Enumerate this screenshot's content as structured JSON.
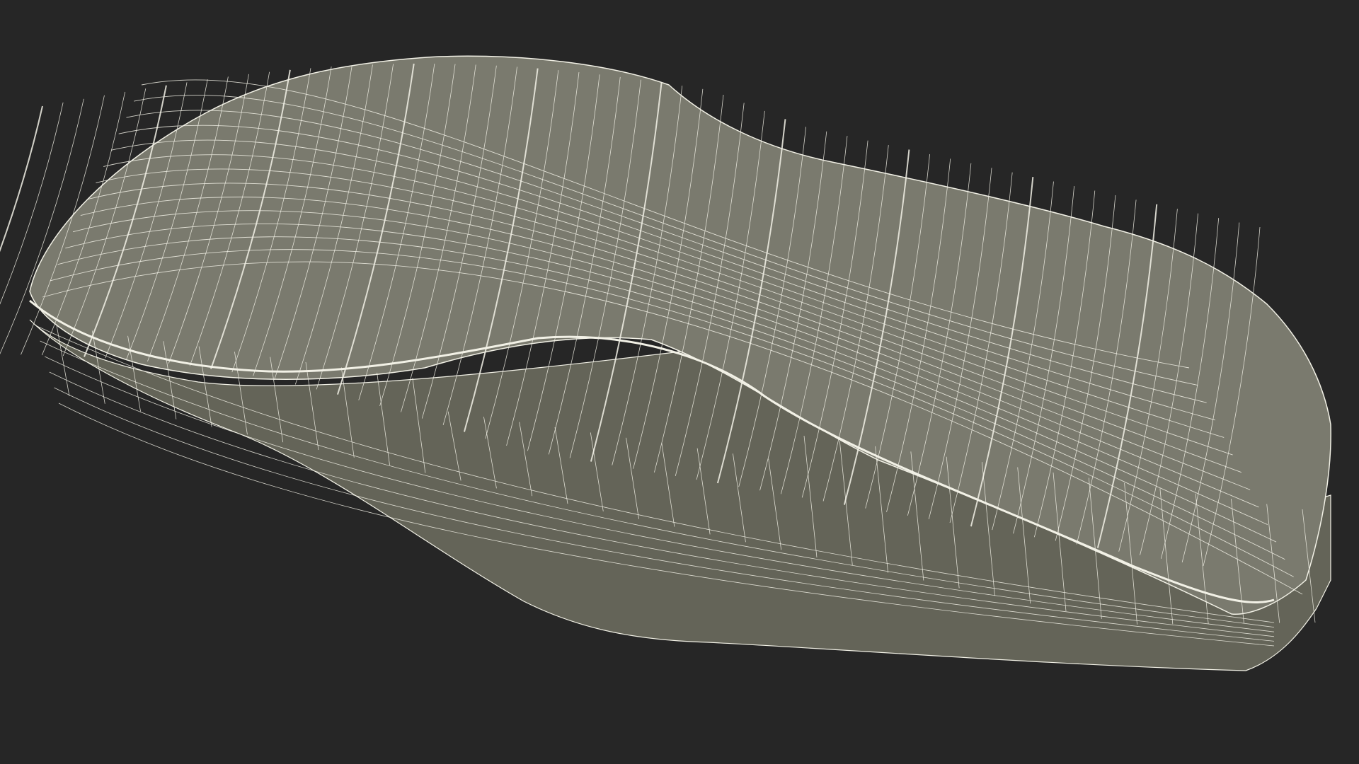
{
  "scene": {
    "subject": "shoe-sole-wireframe",
    "background_color": "#262626",
    "surface_color": "#7a7a6e",
    "surface_shadow_color": "#646458",
    "wire_color": "#f2f1e6"
  }
}
